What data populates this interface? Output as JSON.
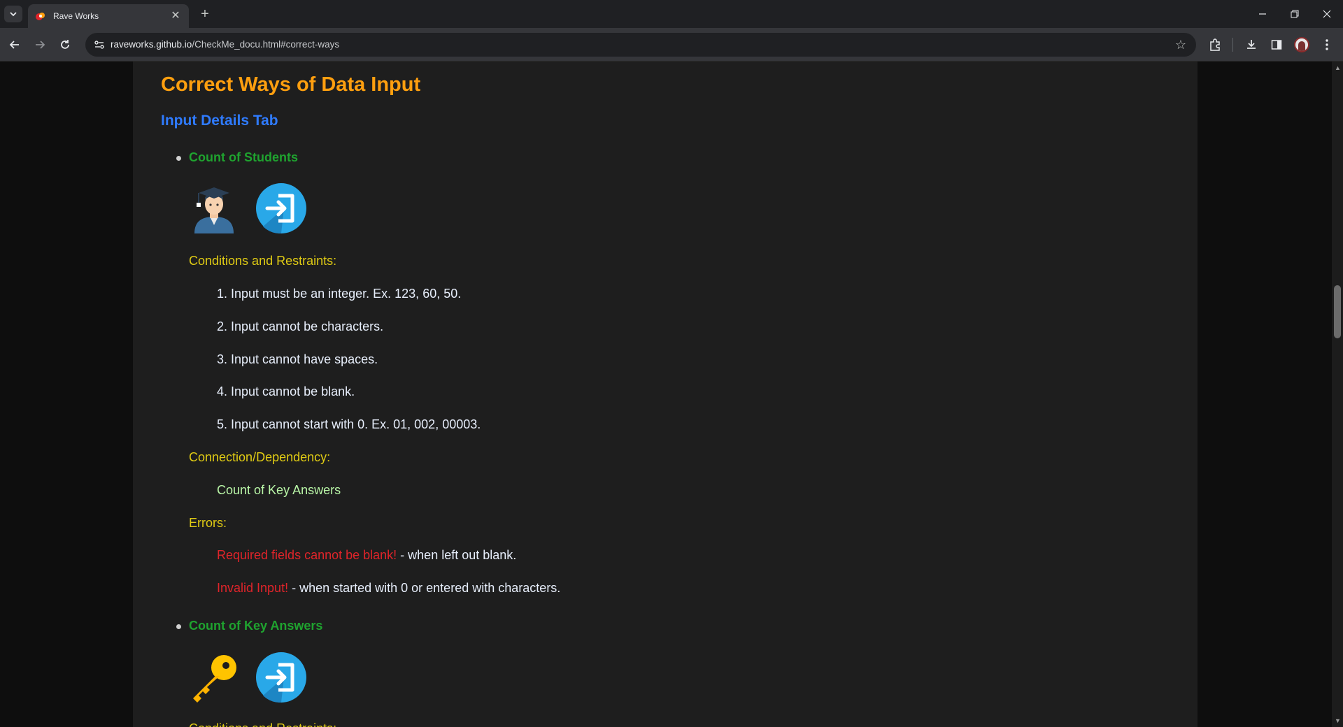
{
  "browser": {
    "tab_title": "Rave Works",
    "url_host": "raveworks.github.io",
    "url_path": "/CheckMe_docu.html#correct-ways",
    "new_tab_symbol": "+",
    "close_symbol": "✕"
  },
  "page": {
    "heading": "Correct Ways of Data Input",
    "subheading": "Input Details Tab",
    "items": [
      {
        "title": "Count of Students",
        "icons": [
          "student-icon",
          "input-arrow-icon"
        ],
        "conditions_label": "Conditions and Restraints:",
        "conditions": [
          "1. Input must be an integer. Ex. 123, 60, 50.",
          "2. Input cannot be characters.",
          "3. Input cannot have spaces.",
          "4. Input cannot be blank.",
          "5. Input cannot start with 0. Ex. 01, 002, 00003."
        ],
        "dependency_label": "Connection/Dependency:",
        "dependency": "Count of Key Answers",
        "errors_label": "Errors:",
        "errors": [
          {
            "message": "Required fields cannot be blank!",
            "description": " - when left out blank."
          },
          {
            "message": "Invalid Input!",
            "description": " - when started with 0 or entered with characters."
          }
        ]
      },
      {
        "title": "Count of Key Answers",
        "icons": [
          "key-icon",
          "input-arrow-icon"
        ],
        "conditions_label": "Conditions and Restraints:"
      }
    ]
  },
  "colors": {
    "heading": "#ff9f0f",
    "subheading": "#2f7bff",
    "item_title": "#1fa32f",
    "label": "#e0cb14",
    "error": "#e0242a",
    "dependency": "#b9f6a7"
  }
}
